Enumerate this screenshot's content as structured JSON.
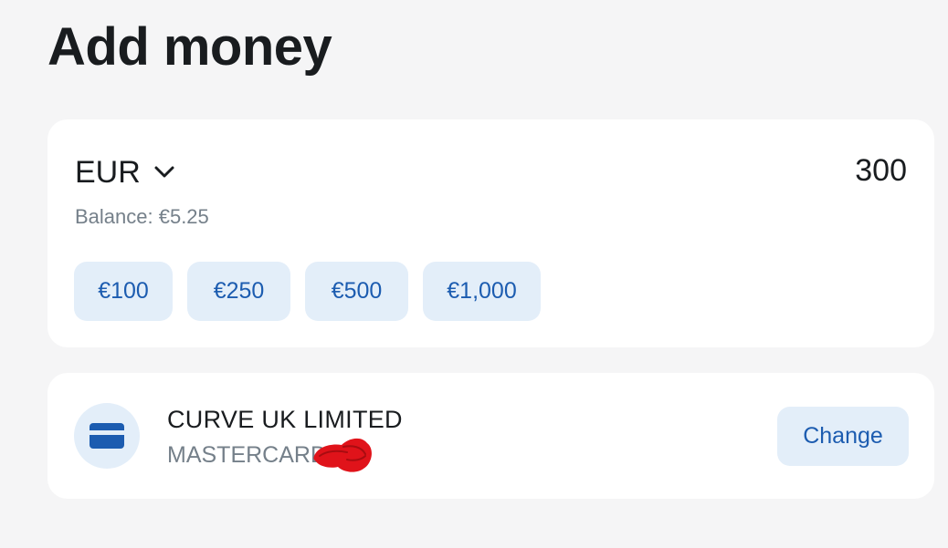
{
  "page": {
    "title": "Add money"
  },
  "amount_card": {
    "currency": "EUR",
    "amount": "300",
    "balance": "Balance: €5.25",
    "presets": [
      "€100",
      "€250",
      "€500",
      "€1,000"
    ]
  },
  "payment_method": {
    "name": "CURVE UK LIMITED",
    "type": "MASTERCARD",
    "change_label": "Change"
  },
  "icons": {
    "currency_dropdown": "chevron-down-icon",
    "payment_card": "credit-card-icon",
    "redaction": "red-scribble"
  },
  "colors": {
    "background": "#f5f5f6",
    "card": "#ffffff",
    "accent": "#1c5cb0",
    "chip_background": "#e3eef9",
    "muted_text": "#75808a",
    "redaction": "#e0131a"
  }
}
